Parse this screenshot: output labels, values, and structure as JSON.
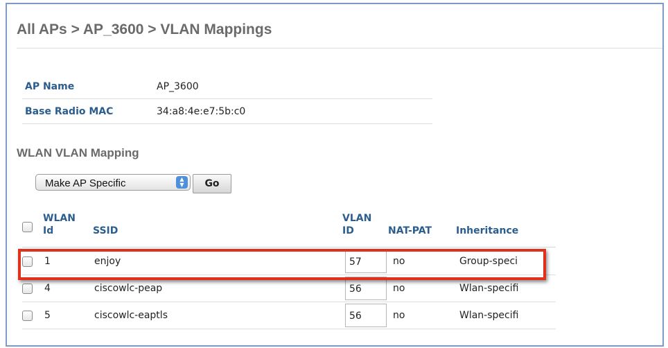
{
  "breadcrumb": "All APs > AP_3600 > VLAN Mappings",
  "ap_info": [
    {
      "label": "AP Name",
      "value": "AP_3600"
    },
    {
      "label": "Base Radio MAC",
      "value": "34:a8:4e:e7:5b:c0"
    }
  ],
  "section_title": "WLAN VLAN Mapping",
  "action": {
    "selected": "Make AP Specific",
    "go_label": "Go"
  },
  "table": {
    "headers": {
      "wlan_id": [
        "WLAN",
        "Id"
      ],
      "ssid": "SSID",
      "vlan_id": [
        "VLAN",
        "ID"
      ],
      "nat_pat": "NAT-PAT",
      "inheritance": "Inheritance"
    },
    "rows": [
      {
        "wlan_id": "1",
        "ssid": "enjoy",
        "vlan_id": "57",
        "nat_pat": "no",
        "inheritance": "Group-speci",
        "highlighted": true
      },
      {
        "wlan_id": "4",
        "ssid": "ciscowlc-peap",
        "vlan_id": "56",
        "nat_pat": "no",
        "inheritance": "Wlan-specifi",
        "highlighted": false
      },
      {
        "wlan_id": "5",
        "ssid": "ciscowlc-eaptls",
        "vlan_id": "56",
        "nat_pat": "no",
        "inheritance": "Wlan-specifi",
        "highlighted": false
      }
    ]
  },
  "colors": {
    "highlight": "#e0311e",
    "header_text": "#2b5d8e",
    "frame": "#7d9bc4"
  }
}
